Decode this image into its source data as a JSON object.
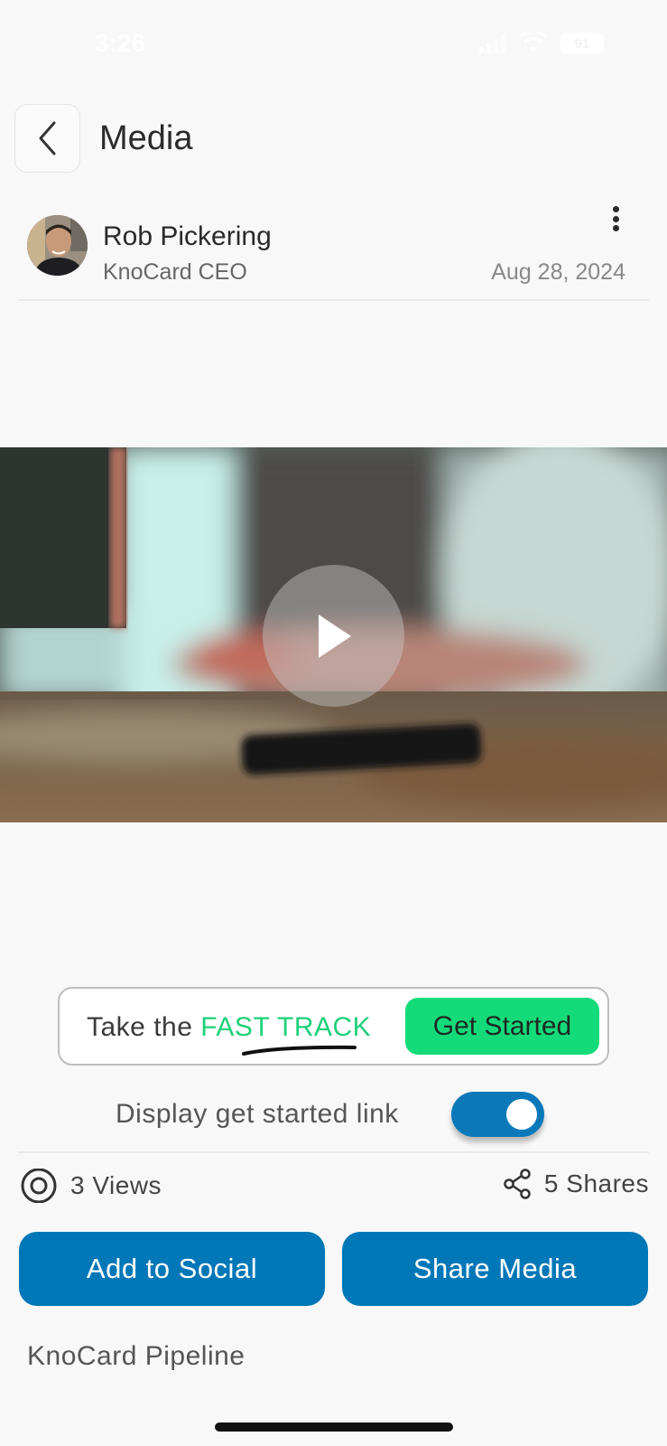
{
  "status_bar": {
    "time": "3:26",
    "battery": "91"
  },
  "header": {
    "title": "Media"
  },
  "author": {
    "name": "Rob Pickering",
    "role": "KnoCard CEO",
    "date": "Aug 28, 2024"
  },
  "cta": {
    "prefix": "Take the ",
    "highlight": "FAST TRACK",
    "button_label": "Get Started",
    "highlight_color": "#1fd07a",
    "button_color": "#14db7a"
  },
  "toggle": {
    "label": "Display get started link",
    "enabled": true
  },
  "stats": {
    "views": "3 Views",
    "shares": "5 Shares"
  },
  "actions": {
    "add_to_social": "Add to Social",
    "share_media": "Share Media"
  },
  "pipeline": {
    "label": "KnoCard Pipeline"
  },
  "colors": {
    "primary": "#0077b7",
    "background": "#f8f8f8"
  }
}
